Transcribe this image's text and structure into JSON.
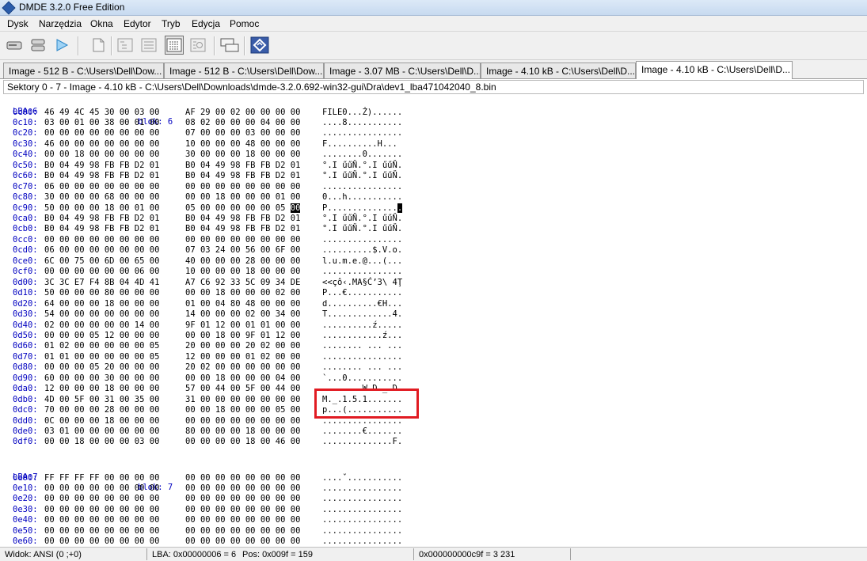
{
  "window": {
    "title": "DMDE 3.2.0 Free Edition"
  },
  "menu": [
    "Dysk",
    "Narzędzia",
    "Okna",
    "Edytor",
    "Tryb",
    "Edycja",
    "Pomoc"
  ],
  "tabs": [
    "Image - 512 B - C:\\Users\\Dell\\Dow...",
    "Image - 512 B - C:\\Users\\Dell\\Dow...",
    "Image - 3.07 MB - C:\\Users\\Dell\\D...",
    "Image - 4.10 kB - C:\\Users\\Dell\\D...",
    "Image - 4.10 kB - C:\\Users\\Dell\\D..."
  ],
  "path": "Sektory 0 - 7 - Image - 4.10 kB - C:\\Users\\Dell\\Downloads\\dmde-3.2.0.692-win32-gui\\Dra\\dev1_lba471042040_8.bin",
  "block6": {
    "lba": "LBA:6",
    "blok": "blok: 6"
  },
  "rows6": [
    {
      "o": "0c00:",
      "a": "46 49 4C 45 30 00 03 00",
      "b": "AF 29 00 02 00 00 00 00",
      "t": "FILE0...Ż)......"
    },
    {
      "o": "0c10:",
      "a": "03 00 01 00 38 00 01 00",
      "b": "08 02 00 00 00 04 00 00",
      "t": "....8..........."
    },
    {
      "o": "0c20:",
      "a": "00 00 00 00 00 00 00 00",
      "b": "07 00 00 00 03 00 00 00",
      "t": "................"
    },
    {
      "o": "0c30:",
      "a": "46 00 00 00 00 00 00 00",
      "b": "10 00 00 00 48 00 00 00",
      "t": "F..........H..."
    },
    {
      "o": "0c40:",
      "a": "00 00 18 00 00 00 00 00",
      "b": "30 00 00 00 18 00 00 00",
      "t": "........0......."
    },
    {
      "o": "0c50:",
      "a": "B0 04 49 98 FB FB D2 01",
      "b": "B0 04 49 98 FB FB D2 01",
      "t": "°.I űűŇ.°.I űűŇ."
    },
    {
      "o": "0c60:",
      "a": "B0 04 49 98 FB FB D2 01",
      "b": "B0 04 49 98 FB FB D2 01",
      "t": "°.I űűŇ.°.I űűŇ."
    },
    {
      "o": "0c70:",
      "a": "06 00 00 00 00 00 00 00",
      "b": "00 00 00 00 00 00 00 00",
      "t": "................"
    },
    {
      "o": "0c80:",
      "a": "30 00 00 00 68 00 00 00",
      "b": "00 00 18 00 00 00 01 00",
      "t": "0...h..........."
    },
    {
      "o": "0c90:",
      "a": "50 00 00 00 18 00 01 00",
      "b": "05 00 00 00 00 00 05 00",
      "t": "P..............."
    },
    {
      "o": "0ca0:",
      "a": "B0 04 49 98 FB FB D2 01",
      "b": "B0 04 49 98 FB FB D2 01",
      "t": "°.I űűŇ.°.I űűŇ."
    },
    {
      "o": "0cb0:",
      "a": "B0 04 49 98 FB FB D2 01",
      "b": "B0 04 49 98 FB FB D2 01",
      "t": "°.I űűŇ.°.I űűŇ."
    },
    {
      "o": "0cc0:",
      "a": "00 00 00 00 00 00 00 00",
      "b": "00 00 00 00 00 00 00 00",
      "t": "................"
    },
    {
      "o": "0cd0:",
      "a": "06 00 00 00 00 00 00 00",
      "b": "07 03 24 00 56 00 6F 00",
      "t": "..........$.V.o."
    },
    {
      "o": "0ce0:",
      "a": "6C 00 75 00 6D 00 65 00",
      "b": "40 00 00 00 28 00 00 00",
      "t": "l.u.m.e.@...(..."
    },
    {
      "o": "0cf0:",
      "a": "00 00 00 00 00 00 06 00",
      "b": "10 00 00 00 18 00 00 00",
      "t": "................"
    },
    {
      "o": "0d00:",
      "a": "3C 3C E7 F4 8B 04 4D 41",
      "b": "A7 C6 92 33 5C 09 34 DE",
      "t": "<<çô‹.MA§Ć’3\\ 4Ţ"
    },
    {
      "o": "0d10:",
      "a": "50 00 00 00 80 00 00 00",
      "b": "00 00 18 00 00 00 02 00",
      "t": "P...€..........."
    },
    {
      "o": "0d20:",
      "a": "64 00 00 00 18 00 00 00",
      "b": "01 00 04 80 48 00 00 00",
      "t": "d..........€H..."
    },
    {
      "o": "0d30:",
      "a": "54 00 00 00 00 00 00 00",
      "b": "14 00 00 00 02 00 34 00",
      "t": "T.............4."
    },
    {
      "o": "0d40:",
      "a": "02 00 00 00 00 00 14 00",
      "b": "9F 01 12 00 01 01 00 00",
      "t": "..........ź....."
    },
    {
      "o": "0d50:",
      "a": "00 00 00 05 12 00 00 00",
      "b": "00 00 18 00 9F 01 12 00",
      "t": "............ź..."
    },
    {
      "o": "0d60:",
      "a": "01 02 00 00 00 00 00 05",
      "b": "20 00 00 00 20 02 00 00",
      "t": "........ ... ..."
    },
    {
      "o": "0d70:",
      "a": "01 01 00 00 00 00 00 05",
      "b": "12 00 00 00 01 02 00 00",
      "t": "................"
    },
    {
      "o": "0d80:",
      "a": "00 00 00 05 20 00 00 00",
      "b": "20 02 00 00 00 00 00 00",
      "t": "........ ... ..."
    },
    {
      "o": "0d90:",
      "a": "60 00 00 00 30 00 00 00",
      "b": "00 00 18 00 00 00 04 00",
      "t": "`...0..........."
    },
    {
      "o": "0da0:",
      "a": "12 00 00 00 18 00 00 00",
      "b": "57 00 44 00 5F 00 44 00",
      "t": "........W.D._.D."
    },
    {
      "o": "0db0:",
      "a": "4D 00 5F 00 31 00 35 00",
      "b": "31 00 00 00 00 00 00 00",
      "t": "M._.1.5.1......."
    },
    {
      "o": "0dc0:",
      "a": "70 00 00 00 28 00 00 00",
      "b": "00 00 18 00 00 00 05 00",
      "t": "p...(..........."
    },
    {
      "o": "0dd0:",
      "a": "0C 00 00 00 18 00 00 00",
      "b": "00 00 00 00 00 00 00 00",
      "t": "................"
    },
    {
      "o": "0de0:",
      "a": "03 01 00 00 00 00 00 00",
      "b": "80 00 00 00 18 00 00 00",
      "t": "........€......."
    },
    {
      "o": "0df0:",
      "a": "00 00 18 00 00 00 03 00",
      "b": "00 00 00 00 18 00 46 00",
      "t": "..............F."
    }
  ],
  "selection": {
    "hex": "00",
    "ascii": "."
  },
  "block7": {
    "lba": "LBA:7",
    "blok": "blok: 7"
  },
  "rows7": [
    {
      "o": "0e00:",
      "a": "FF FF FF FF 00 00 00 00",
      "b": "00 00 00 00 00 00 00 00",
      "t": "....ˇ..........."
    },
    {
      "o": "0e10:",
      "a": "00 00 00 00 00 00 00 00",
      "b": "00 00 00 00 00 00 00 00",
      "t": "................"
    },
    {
      "o": "0e20:",
      "a": "00 00 00 00 00 00 00 00",
      "b": "00 00 00 00 00 00 00 00",
      "t": "................"
    },
    {
      "o": "0e30:",
      "a": "00 00 00 00 00 00 00 00",
      "b": "00 00 00 00 00 00 00 00",
      "t": "................"
    },
    {
      "o": "0e40:",
      "a": "00 00 00 00 00 00 00 00",
      "b": "00 00 00 00 00 00 00 00",
      "t": "................"
    },
    {
      "o": "0e50:",
      "a": "00 00 00 00 00 00 00 00",
      "b": "00 00 00 00 00 00 00 00",
      "t": "................"
    },
    {
      "o": "0e60:",
      "a": "00 00 00 00 00 00 00 00",
      "b": "00 00 00 00 00 00 00 00",
      "t": "................"
    }
  ],
  "status": {
    "view": "Widok:  ANSI (0 ;+0)",
    "lba": "LBA: 0x00000006 = 6",
    "pos": "Pos: 0x009f = 159",
    "offset": "0x000000000c9f = 3 231"
  },
  "icons": [
    "app-logo-icon",
    "disk-icon",
    "partitions-icon",
    "play-icon",
    "new-file-icon",
    "tree-view-icon",
    "list-view-icon",
    "hex-view-icon",
    "find-view-icon",
    "copy-windows-icon",
    "dmde-logo-icon"
  ],
  "colors": {
    "offset": "#0000c0",
    "highlight": "#e11b22",
    "selection": "#000000"
  }
}
